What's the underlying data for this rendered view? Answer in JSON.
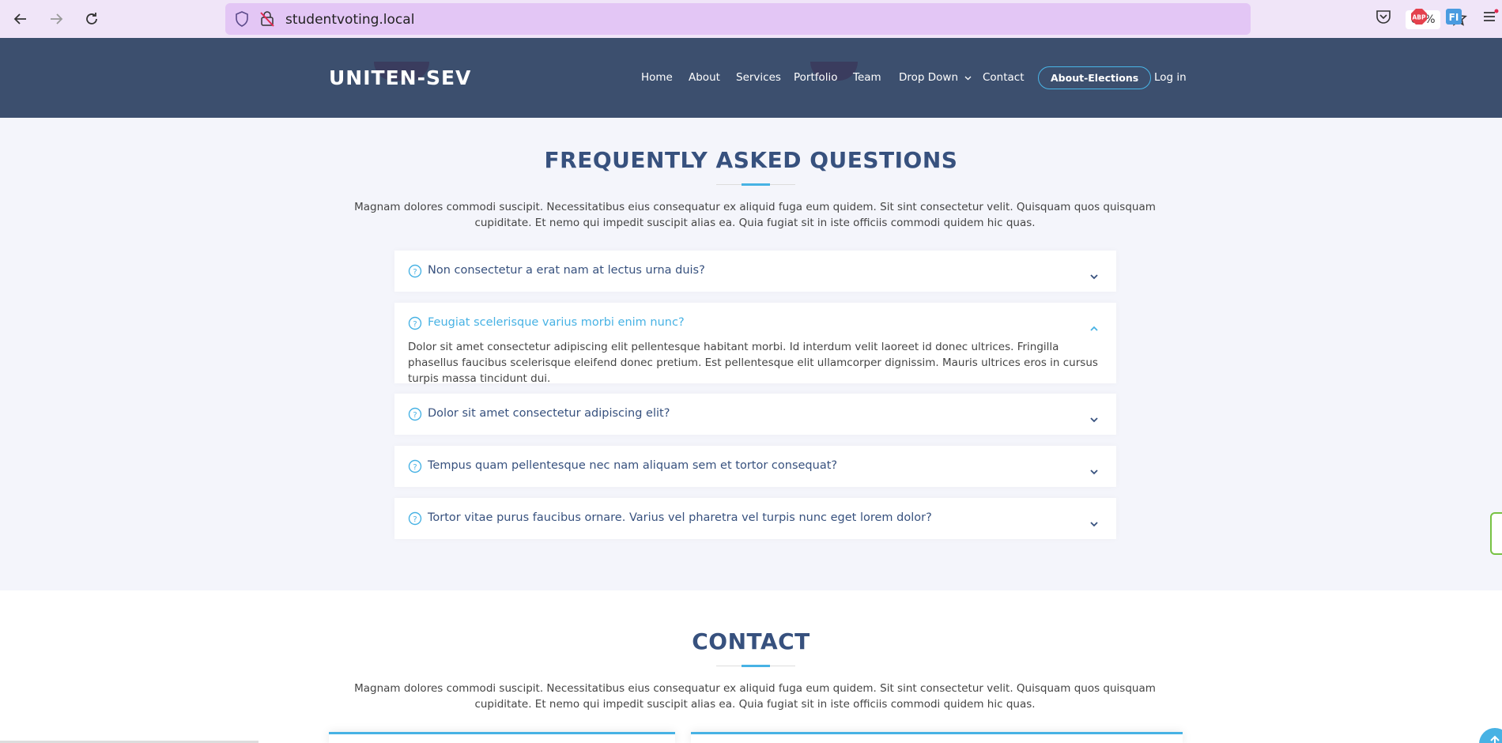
{
  "browser": {
    "url": "studentvoting.local",
    "zoom": "67%",
    "extension_icons": [
      "pocket-icon",
      "adblock-icon",
      "ft-icon",
      "menu-icon"
    ]
  },
  "header": {
    "logo": "UNITEN-SEV",
    "nav": [
      {
        "label": "Home"
      },
      {
        "label": "About"
      },
      {
        "label": "Services"
      },
      {
        "label": "Portfolio"
      },
      {
        "label": "Team"
      },
      {
        "label": "Drop Down"
      },
      {
        "label": "Contact"
      },
      {
        "label": "About-Elections"
      },
      {
        "label": "Log in"
      }
    ]
  },
  "faq": {
    "title": "FREQUENTLY ASKED QUESTIONS",
    "intro": "Magnam dolores commodi suscipit. Necessitatibus eius consequatur ex aliquid fuga eum quidem. Sit sint consectetur velit. Quisquam quos quisquam cupiditate. Et nemo qui impedit suscipit alias ea. Quia fugiat sit in iste officiis commodi quidem hic quas.",
    "items": [
      {
        "question": "Non consectetur a erat nam at lectus urna duis?",
        "expanded": false
      },
      {
        "question": "Feugiat scelerisque varius morbi enim nunc?",
        "expanded": true,
        "answer": "Dolor sit amet consectetur adipiscing elit pellentesque habitant morbi. Id interdum velit laoreet id donec ultrices. Fringilla phasellus faucibus scelerisque eleifend donec pretium. Est pellentesque elit ullamcorper dignissim. Mauris ultrices eros in cursus turpis massa tincidunt dui."
      },
      {
        "question": "Dolor sit amet consectetur adipiscing elit?",
        "expanded": false
      },
      {
        "question": "Tempus quam pellentesque nec nam aliquam sem et tortor consequat?",
        "expanded": false
      },
      {
        "question": "Tortor vitae purus faucibus ornare. Varius vel pharetra vel turpis nunc eget lorem dolor?",
        "expanded": false
      }
    ]
  },
  "contact": {
    "title": "CONTACT",
    "intro": "Magnam dolores commodi suscipit. Necessitatibus eius consequatur ex aliquid fuga eum quidem. Sit sint consectetur velit. Quisquam quos quisquam cupiditate. Et nemo qui impedit suscipit alias ea. Quia fugiat sit in iste officiis commodi quidem hic quas."
  },
  "colors": {
    "header_bg": "#3c4f6e",
    "accent": "#47b2e4",
    "title": "#37517e",
    "section_bg": "#f4f5fb"
  }
}
